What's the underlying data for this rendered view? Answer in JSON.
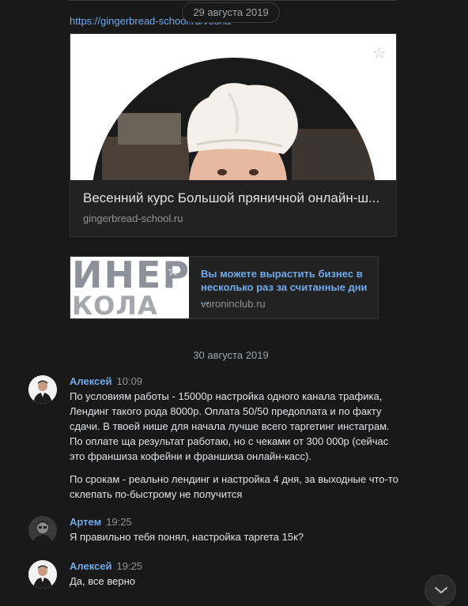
{
  "date_header_1": "29 августа 2019",
  "link_url": "https://gingerbread-school.ru/vesna",
  "card1": {
    "title": "Весенний курс Большой пряничной онлайн-ш...",
    "domain": "gingerbread-school.ru"
  },
  "card2": {
    "image_text_line1": "ИНЕР",
    "image_text_line2": "КОЛА БИ",
    "title": "Вы можете вырастить бизнес в несколько раз за считанные дни ...",
    "domain": "voroninclub.ru"
  },
  "date_header_2": "30 августа 2019",
  "messages": [
    {
      "author": "Алексей",
      "time": "10:09",
      "paragraphs": [
        "По условиям работы - 15000р настройка одного канала трафика, Лендинг такого рода 8000р. Оплата 50/50 предоплата и по факту сдачи. В твоей нише для начала лучше всего таргетинг инстаграм. По оплате ща результат работаю, но с чеками от 300 000р (сейчас это франшиза кофейни и франшиза онлайн-касс).",
        "По срокам - реально лендинг и настройка 4 дня, за выходные что-то склепать по-быстрому не получится"
      ]
    },
    {
      "author": "Артем",
      "time": "19:25",
      "paragraphs": [
        "Я правильно тебя понял, настройка таргета 15к?"
      ]
    },
    {
      "author": "Алексей",
      "time": "19:25",
      "paragraphs": [
        "Да, все верно"
      ]
    }
  ],
  "icons": {
    "star": "star-icon",
    "scroll_down": "chevron-down-icon"
  },
  "colors": {
    "background": "#191919",
    "link": "#71aaeb",
    "text": "#e1e3e6",
    "muted": "#939393"
  }
}
